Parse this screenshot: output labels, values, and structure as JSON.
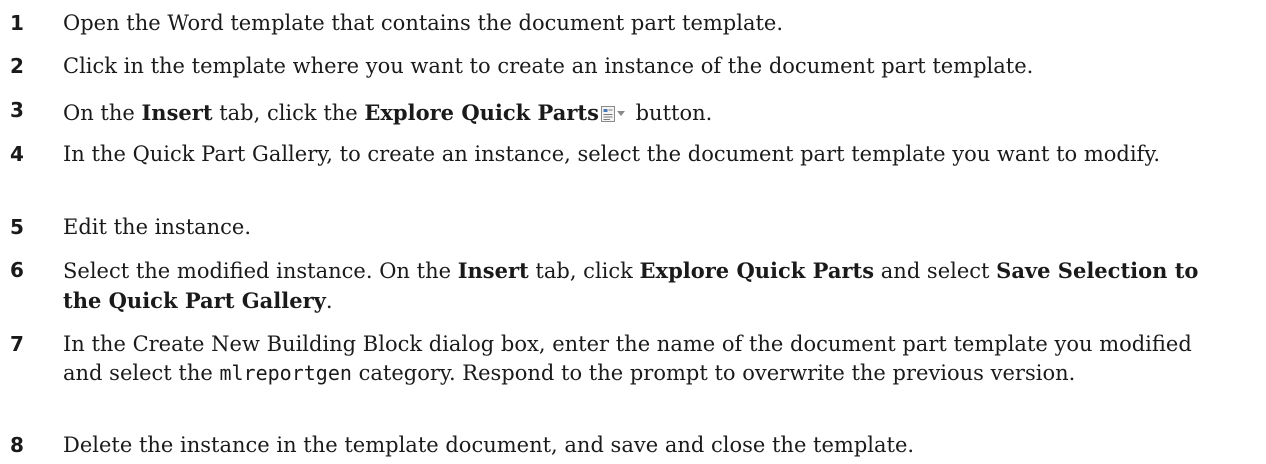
{
  "steps": [
    {
      "number": "1",
      "text": "Open the Word template that contains the document part template."
    },
    {
      "number": "2",
      "text": "Click in the template where you want to create an instance of the document part template."
    },
    {
      "number": "3",
      "t1": "On the ",
      "b1": "Insert",
      "t2": " tab, click the ",
      "b2": "Explore Quick Parts",
      "t3": " button.",
      "icon": "quick-parts-icon"
    },
    {
      "number": "4",
      "text": "In the Quick Part Gallery, to create an instance, select the document part template you want to modify."
    },
    {
      "number": "5",
      "text": "Edit the instance."
    },
    {
      "number": "6",
      "t1": "Select the modified instance. On the ",
      "b1": "Insert",
      "t2": " tab, click ",
      "b2": "Explore Quick Parts",
      "t3": " and select ",
      "b3": "Save Selection to the Quick Part Gallery",
      "t4": "."
    },
    {
      "number": "7",
      "t1": "In the Create New Building Block dialog box, enter the name of the document part template you modified and select the ",
      "code": "mlreportgen",
      "t2": " category. Respond to the prompt to overwrite the previous version."
    },
    {
      "number": "8",
      "text": "Delete the instance in the template document, and save and close the template."
    }
  ]
}
